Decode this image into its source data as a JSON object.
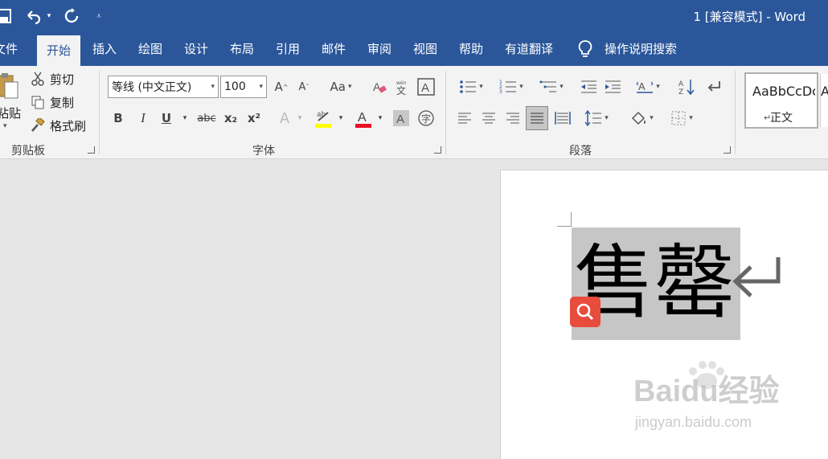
{
  "titlebar": {
    "doc_title": "1 [兼容模式] - Word",
    "qat_icons": [
      "save-icon",
      "undo-icon",
      "redo-icon",
      "customize-qat-icon"
    ]
  },
  "menubar": {
    "tabs": [
      {
        "label": "文件",
        "active": false
      },
      {
        "label": "开始",
        "active": true
      },
      {
        "label": "插入",
        "active": false
      },
      {
        "label": "绘图",
        "active": false
      },
      {
        "label": "设计",
        "active": false
      },
      {
        "label": "布局",
        "active": false
      },
      {
        "label": "引用",
        "active": false
      },
      {
        "label": "邮件",
        "active": false
      },
      {
        "label": "审阅",
        "active": false
      },
      {
        "label": "视图",
        "active": false
      },
      {
        "label": "帮助",
        "active": false
      },
      {
        "label": "有道翻译",
        "active": false
      }
    ],
    "tell_me": "操作说明搜索"
  },
  "ribbon": {
    "clipboard": {
      "paste_label": "粘贴",
      "cut_label": "剪切",
      "copy_label": "复制",
      "format_painter_label": "格式刷",
      "group_label": "剪贴板"
    },
    "font": {
      "font_name": "等线 (中文正文)",
      "font_size": "100",
      "bold": "B",
      "italic": "I",
      "underline": "U",
      "strike": "abc",
      "sub": "x₂",
      "sup": "x²",
      "change_case": "Aa",
      "group_label": "字体"
    },
    "paragraph": {
      "group_label": "段落"
    },
    "styles": {
      "sample": "AaBbCcDc",
      "name": "正文"
    }
  },
  "document": {
    "text": "售罄",
    "paragraph_mark": "↵"
  },
  "watermark": {
    "line1": "Baidu经验",
    "line2": "jingyan.baidu.com"
  },
  "colors": {
    "word_blue": "#2b579a",
    "ribbon_bg": "#f3f3f3",
    "highlight_yellow": "#ffff00",
    "font_red": "#e81123",
    "selection_gray": "#c6c6c6",
    "search_badge_red": "#e74c3c"
  }
}
